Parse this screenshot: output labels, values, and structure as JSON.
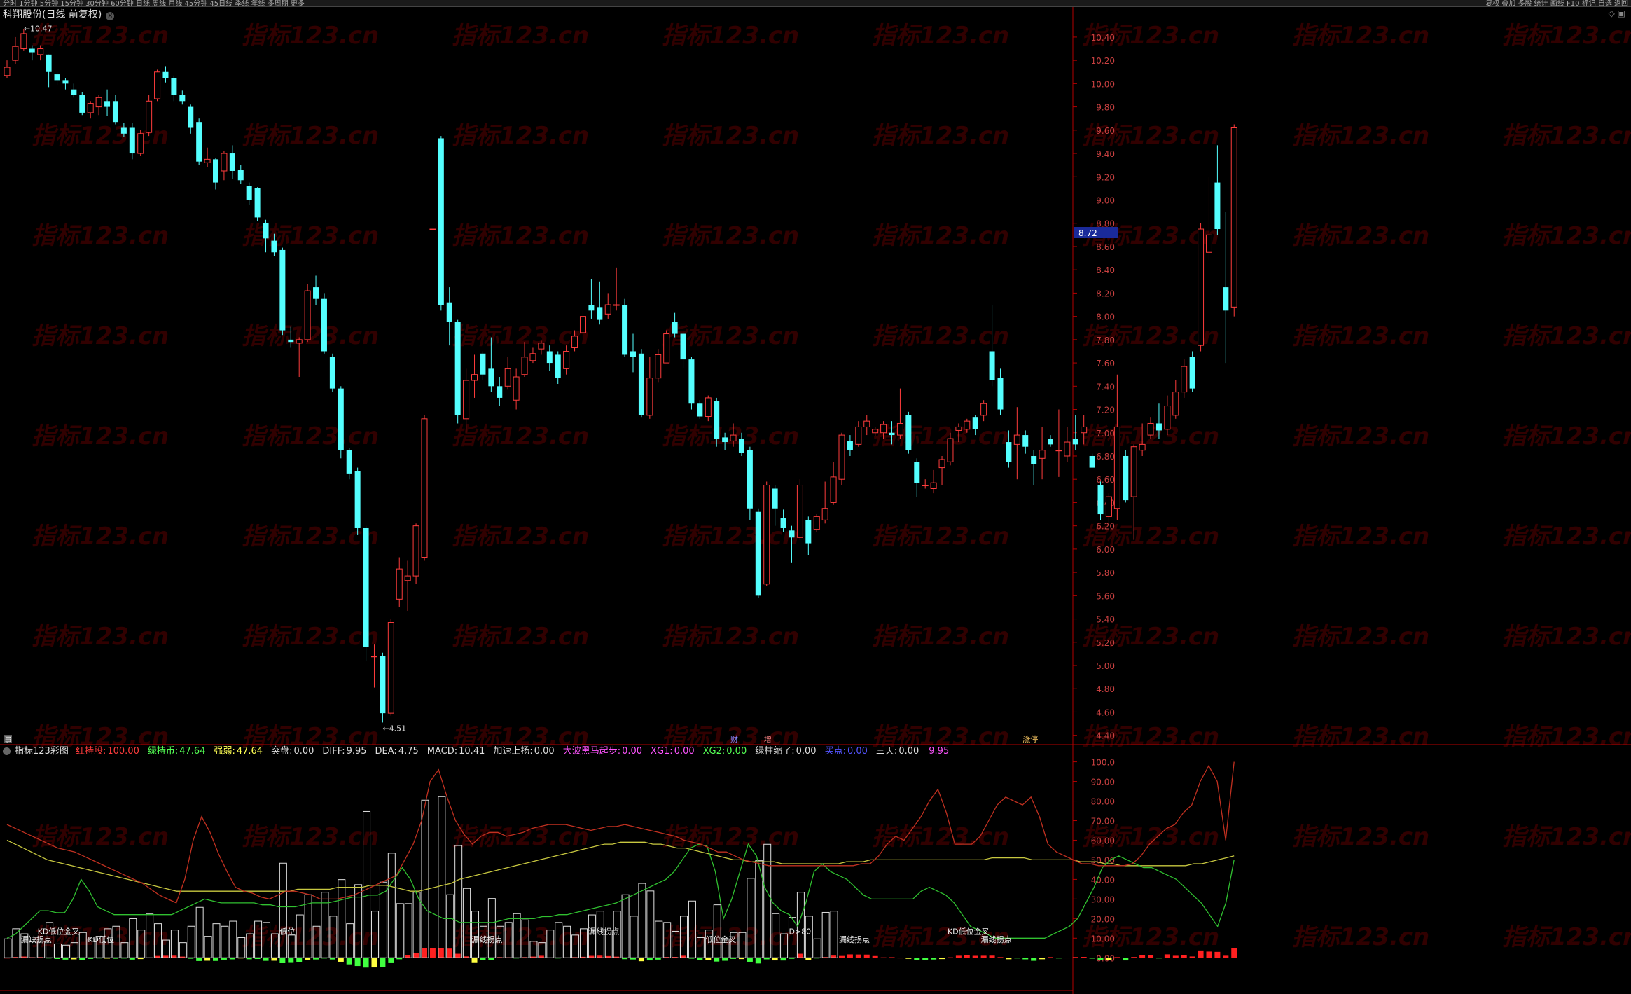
{
  "toolbar_left": "分时 1分钟 5分钟 15分钟 30分钟 60分钟 日线 周线 月线 45分钟 45日线 季线 年线 多周期 更多",
  "toolbar_right": "复权 叠加 多股 统计 画线 F10 标记 自选 返回",
  "title": {
    "name": "科翔股份",
    "mode": "(日线 前复权)"
  },
  "watermark": "指标123.cn",
  "colors": {
    "up": "#ff3c3c",
    "down": "#54ffff",
    "bg": "#000000",
    "axis": "#b40000",
    "grid": "#3c0000"
  },
  "price_axis": {
    "ticks": [
      "10.40",
      "10.20",
      "10.00",
      "9.80",
      "9.60",
      "9.40",
      "9.20",
      "9.00",
      "8.80",
      "8.60",
      "8.40",
      "8.20",
      "8.00",
      "7.80",
      "7.60",
      "7.40",
      "7.20",
      "7.00",
      "6.80",
      "6.60",
      "6.40",
      "6.20",
      "6.00",
      "5.80",
      "5.60",
      "5.40",
      "5.20",
      "5.00",
      "4.80",
      "4.60",
      "4.40"
    ],
    "current": "8.72"
  },
  "annotations": {
    "high": "10.47",
    "low": "4.51"
  },
  "event_markers": [
    "事",
    "财",
    "增",
    "涨停"
  ],
  "chart_data": {
    "type": "candlestick",
    "ylim": [
      4.35,
      10.55
    ],
    "candles": [
      [
        10.07,
        10.14,
        10.05,
        10.2
      ],
      [
        10.2,
        10.32,
        10.17,
        10.4
      ],
      [
        10.3,
        10.43,
        10.28,
        10.47
      ],
      [
        10.3,
        10.27,
        10.2,
        10.33
      ],
      [
        10.25,
        10.3,
        10.2,
        10.33
      ],
      [
        10.25,
        10.1,
        9.97,
        10.25
      ],
      [
        10.08,
        10.03,
        9.99,
        10.1
      ],
      [
        10.03,
        10.0,
        9.95,
        10.05
      ],
      [
        9.95,
        9.9,
        9.88,
        10.0
      ],
      [
        9.9,
        9.75,
        9.73,
        9.93
      ],
      [
        9.75,
        9.83,
        9.7,
        9.85
      ],
      [
        9.8,
        9.88,
        9.73,
        9.9
      ],
      [
        9.85,
        9.8,
        9.72,
        9.95
      ],
      [
        9.85,
        9.67,
        9.65,
        9.9
      ],
      [
        9.62,
        9.57,
        9.54,
        9.66
      ],
      [
        9.62,
        9.4,
        9.35,
        9.66
      ],
      [
        9.4,
        9.57,
        9.38,
        9.6
      ],
      [
        9.58,
        9.85,
        9.55,
        9.9
      ],
      [
        9.87,
        10.1,
        9.85,
        10.12
      ],
      [
        10.1,
        10.05,
        10.01,
        10.15
      ],
      [
        10.05,
        9.9,
        9.85,
        10.07
      ],
      [
        9.9,
        9.85,
        9.82,
        9.94
      ],
      [
        9.8,
        9.62,
        9.57,
        9.82
      ],
      [
        9.67,
        9.33,
        9.3,
        9.7
      ],
      [
        9.32,
        9.35,
        9.28,
        9.45
      ],
      [
        9.35,
        9.15,
        9.09,
        9.36
      ],
      [
        9.25,
        9.4,
        9.17,
        9.42
      ],
      [
        9.4,
        9.25,
        9.18,
        9.47
      ],
      [
        9.26,
        9.17,
        9.14,
        9.3
      ],
      [
        9.12,
        9.0,
        8.96,
        9.15
      ],
      [
        9.1,
        8.85,
        8.82,
        9.11
      ],
      [
        8.8,
        8.67,
        8.55,
        8.83
      ],
      [
        8.65,
        8.55,
        8.52,
        8.71
      ],
      [
        8.57,
        7.88,
        7.84,
        8.59
      ],
      [
        7.8,
        7.78,
        7.73,
        7.91
      ],
      [
        7.77,
        7.8,
        7.48,
        7.82
      ],
      [
        7.8,
        8.22,
        7.78,
        8.28
      ],
      [
        8.25,
        8.15,
        8.1,
        8.35
      ],
      [
        8.15,
        7.7,
        7.68,
        8.2
      ],
      [
        7.65,
        7.38,
        7.35,
        7.68
      ],
      [
        7.38,
        6.85,
        6.78,
        7.4
      ],
      [
        6.85,
        6.65,
        6.6,
        6.87
      ],
      [
        6.67,
        6.18,
        6.12,
        6.7
      ],
      [
        6.18,
        5.16,
        5.04,
        6.2
      ],
      [
        5.08,
        5.08,
        4.81,
        5.18
      ],
      [
        5.08,
        4.59,
        4.51,
        5.11
      ],
      [
        4.59,
        5.37,
        4.57,
        5.4
      ],
      [
        5.57,
        5.83,
        5.5,
        5.93
      ],
      [
        5.73,
        5.77,
        5.47,
        5.9
      ],
      [
        5.77,
        6.2,
        5.7,
        6.22
      ],
      [
        5.93,
        7.12,
        5.9,
        7.15
      ],
      [
        8.75,
        8.75,
        8.75,
        8.75
      ],
      [
        9.53,
        8.1,
        8.05,
        9.55
      ],
      [
        8.12,
        7.95,
        7.75,
        8.25
      ],
      [
        7.95,
        7.15,
        7.08,
        7.97
      ],
      [
        7.12,
        7.45,
        7.0,
        7.55
      ],
      [
        7.45,
        7.5,
        7.3,
        7.67
      ],
      [
        7.68,
        7.5,
        7.45,
        7.7
      ],
      [
        7.55,
        7.4,
        7.35,
        7.82
      ],
      [
        7.4,
        7.3,
        7.23,
        7.48
      ],
      [
        7.4,
        7.55,
        7.37,
        7.65
      ],
      [
        7.28,
        7.48,
        7.2,
        7.55
      ],
      [
        7.5,
        7.65,
        7.48,
        7.78
      ],
      [
        7.62,
        7.68,
        7.6,
        7.73
      ],
      [
        7.72,
        7.77,
        7.67,
        7.79
      ],
      [
        7.7,
        7.6,
        7.53,
        7.75
      ],
      [
        7.67,
        7.47,
        7.42,
        7.7
      ],
      [
        7.55,
        7.7,
        7.5,
        7.75
      ],
      [
        7.73,
        7.83,
        7.7,
        7.88
      ],
      [
        7.86,
        8.0,
        7.82,
        8.05
      ],
      [
        8.1,
        8.05,
        7.98,
        8.32
      ],
      [
        8.08,
        7.97,
        7.93,
        8.3
      ],
      [
        8.02,
        8.1,
        7.98,
        8.2
      ],
      [
        8.1,
        8.1,
        8.05,
        8.42
      ],
      [
        8.1,
        7.67,
        7.65,
        8.15
      ],
      [
        7.7,
        7.65,
        7.52,
        7.85
      ],
      [
        7.68,
        7.15,
        7.13,
        7.72
      ],
      [
        7.15,
        7.47,
        7.12,
        7.65
      ],
      [
        7.47,
        7.67,
        7.43,
        7.72
      ],
      [
        7.6,
        7.85,
        7.6,
        7.88
      ],
      [
        7.95,
        7.85,
        7.82,
        8.03
      ],
      [
        7.85,
        7.63,
        7.55,
        7.88
      ],
      [
        7.63,
        7.25,
        7.2,
        7.65
      ],
      [
        7.25,
        7.14,
        7.12,
        7.28
      ],
      [
        7.14,
        7.3,
        7.1,
        7.32
      ],
      [
        7.27,
        6.95,
        6.88,
        7.3
      ],
      [
        6.96,
        6.92,
        6.85,
        7.0
      ],
      [
        6.93,
        6.98,
        6.88,
        7.08
      ],
      [
        6.95,
        6.83,
        6.8,
        7.0
      ],
      [
        6.85,
        6.35,
        6.25,
        6.88
      ],
      [
        6.32,
        5.6,
        5.58,
        6.35
      ],
      [
        5.7,
        6.55,
        5.68,
        6.58
      ],
      [
        6.52,
        6.35,
        6.2,
        6.55
      ],
      [
        6.27,
        6.18,
        6.15,
        6.34
      ],
      [
        6.16,
        6.1,
        5.88,
        6.2
      ],
      [
        6.1,
        6.55,
        6.08,
        6.6
      ],
      [
        6.25,
        6.05,
        5.95,
        6.28
      ],
      [
        6.17,
        6.28,
        6.15,
        6.3
      ],
      [
        6.25,
        6.35,
        6.22,
        6.58
      ],
      [
        6.4,
        6.62,
        6.38,
        6.75
      ],
      [
        6.6,
        6.98,
        6.55,
        7.0
      ],
      [
        6.93,
        6.85,
        6.8,
        6.98
      ],
      [
        6.9,
        7.05,
        6.88,
        7.1
      ],
      [
        7.05,
        7.1,
        6.98,
        7.15
      ],
      [
        7.0,
        7.03,
        6.97,
        7.05
      ],
      [
        7.0,
        7.07,
        6.95,
        7.1
      ],
      [
        7.0,
        6.98,
        6.9,
        7.1
      ],
      [
        6.98,
        7.08,
        6.95,
        7.38
      ],
      [
        7.15,
        6.85,
        6.82,
        7.18
      ],
      [
        6.75,
        6.57,
        6.45,
        6.78
      ],
      [
        6.55,
        6.55,
        6.52,
        6.6
      ],
      [
        6.52,
        6.57,
        6.48,
        6.68
      ],
      [
        6.7,
        6.77,
        6.55,
        6.8
      ],
      [
        6.75,
        6.95,
        6.72,
        7.0
      ],
      [
        7.02,
        7.05,
        6.92,
        7.08
      ],
      [
        7.03,
        7.1,
        7.0,
        7.12
      ],
      [
        7.13,
        7.03,
        6.98,
        7.15
      ],
      [
        7.15,
        7.25,
        7.1,
        7.28
      ],
      [
        7.7,
        7.45,
        7.4,
        8.1
      ],
      [
        7.47,
        7.2,
        7.15,
        7.55
      ],
      [
        6.92,
        6.75,
        6.7,
        7.02
      ],
      [
        6.9,
        6.98,
        6.6,
        7.22
      ],
      [
        6.98,
        6.88,
        6.82,
        7.02
      ],
      [
        6.8,
        6.73,
        6.55,
        6.85
      ],
      [
        6.78,
        6.85,
        6.6,
        7.05
      ],
      [
        6.95,
        6.9,
        6.88,
        6.98
      ],
      [
        6.85,
        6.85,
        6.62,
        7.2
      ],
      [
        6.8,
        6.92,
        6.75,
        7.05
      ],
      [
        6.95,
        6.9,
        6.85,
        7.15
      ],
      [
        7.0,
        7.05,
        6.9,
        7.15
      ],
      [
        6.8,
        6.7,
        6.7,
        6.82
      ],
      [
        6.55,
        6.3,
        6.25,
        6.58
      ],
      [
        6.28,
        6.45,
        6.2,
        6.48
      ],
      [
        6.35,
        7.05,
        6.25,
        7.5
      ],
      [
        6.8,
        6.42,
        6.4,
        6.85
      ],
      [
        6.45,
        6.88,
        6.08,
        6.9
      ],
      [
        6.85,
        6.9,
        6.8,
        7.08
      ],
      [
        6.98,
        7.08,
        6.95,
        7.13
      ],
      [
        7.08,
        7.02,
        6.95,
        7.25
      ],
      [
        7.03,
        7.23,
        6.98,
        7.32
      ],
      [
        7.15,
        7.35,
        7.12,
        7.45
      ],
      [
        7.35,
        7.57,
        7.3,
        7.63
      ],
      [
        7.65,
        7.38,
        7.35,
        7.7
      ],
      [
        7.75,
        8.75,
        7.7,
        8.8
      ],
      [
        8.55,
        8.7,
        8.48,
        9.2
      ],
      [
        9.15,
        8.75,
        8.7,
        9.47
      ],
      [
        8.25,
        8.05,
        7.6,
        8.9
      ],
      [
        8.08,
        9.62,
        8.0,
        9.65
      ]
    ]
  },
  "indicator": {
    "name": "指标123彩图",
    "legend": [
      {
        "label": "红持股:",
        "value": "100.00",
        "color": "#ff3c3c"
      },
      {
        "label": "绿持币:",
        "value": "47.64",
        "color": "#54ff54"
      },
      {
        "label": "强弱:",
        "value": "47.64",
        "color": "#ffff54"
      },
      {
        "label": "突盘:",
        "value": "0.00",
        "color": "#dddddd"
      },
      {
        "label": "DIFF:",
        "value": "9.95",
        "color": "#dddddd"
      },
      {
        "label": "DEA:",
        "value": "4.75",
        "color": "#dddddd"
      },
      {
        "label": "MACD:",
        "value": "10.41",
        "color": "#dddddd"
      },
      {
        "label": "加速上扬:",
        "value": "0.00",
        "color": "#dddddd"
      },
      {
        "label": "大波黑马起步:",
        "value": "0.00",
        "color": "#ff54ff"
      },
      {
        "label": "XG1:",
        "value": "0.00",
        "color": "#ff54ff"
      },
      {
        "label": "XG2:",
        "value": "0.00",
        "color": "#54ff54"
      },
      {
        "label": "绿柱缩了:",
        "value": "0.00",
        "color": "#dddddd"
      },
      {
        "label": "买点:",
        "value": "0.00",
        "color": "#5454ff"
      },
      {
        "label": "三天:",
        "value": "0.00",
        "color": "#dddddd"
      },
      {
        "label": "",
        "value": "9.95",
        "color": "#ff54ff"
      }
    ],
    "ticks": [
      "100.0",
      "90.00",
      "80.00",
      "70.00",
      "60.00",
      "50.00",
      "40.00",
      "30.00",
      "20.00",
      "10.00",
      "0.00"
    ],
    "labels": [
      "漏缺拐点",
      "KD低位金叉",
      "KD低位",
      "低位",
      "漏线拐点",
      "漏线拐点",
      "低位金叉",
      "D>80",
      "漏线拐点",
      "KD低位金叉",
      "漏线拐点"
    ],
    "ylim": [
      -16,
      102
    ],
    "red_line": [
      68,
      66,
      64,
      62,
      60,
      58,
      56,
      55,
      54,
      52,
      50,
      48,
      46,
      44,
      42,
      40,
      38,
      35,
      32,
      30,
      28,
      40,
      60,
      72,
      64,
      53,
      44,
      36,
      34,
      33,
      31,
      30,
      32,
      34,
      34,
      33,
      32,
      30,
      30,
      30,
      31,
      32,
      34,
      36,
      38,
      40,
      42,
      50,
      58,
      70,
      90,
      96,
      82,
      70,
      63,
      58,
      62,
      64,
      64,
      62,
      63,
      64,
      66,
      67,
      68,
      68,
      68,
      67,
      66,
      65,
      66,
      67,
      67,
      68,
      67,
      66,
      65,
      64,
      63,
      62,
      60,
      59,
      58,
      56,
      54,
      54,
      52,
      50,
      49,
      48,
      47,
      47,
      47,
      47,
      47,
      47,
      47,
      47,
      47,
      47,
      47,
      48,
      48,
      52,
      58,
      62,
      60,
      66,
      72,
      80,
      86,
      74,
      58,
      58,
      58,
      62,
      70,
      78,
      82,
      80,
      78,
      82,
      72,
      58,
      54,
      52,
      50,
      48,
      48,
      47,
      47,
      47,
      47,
      48,
      52,
      58,
      62,
      66,
      68,
      74,
      78,
      90,
      98,
      90,
      60,
      100
    ],
    "green_line": [
      10,
      12,
      16,
      20,
      24,
      24,
      23,
      23,
      30,
      40,
      34,
      26,
      24,
      22,
      22,
      22,
      22,
      22,
      22,
      22,
      22,
      24,
      26,
      28,
      30,
      29,
      28,
      28,
      28,
      28,
      28,
      27,
      27,
      26,
      26,
      26,
      27,
      28,
      28,
      28,
      29,
      30,
      31,
      31,
      32,
      32,
      34,
      40,
      46,
      40,
      30,
      24,
      22,
      20,
      20,
      18,
      18,
      18,
      18,
      18,
      19,
      20,
      20,
      20,
      20,
      21,
      21,
      22,
      22,
      23,
      24,
      25,
      26,
      27,
      28,
      30,
      32,
      34,
      36,
      38,
      40,
      44,
      50,
      56,
      58,
      57,
      44,
      20,
      30,
      44,
      58,
      52,
      36,
      28,
      24,
      22,
      16,
      28,
      44,
      48,
      44,
      42,
      40,
      36,
      32,
      30,
      30,
      30,
      30,
      30,
      30,
      34,
      36,
      34,
      32,
      28,
      22,
      16,
      14,
      12,
      10,
      10,
      10,
      10,
      10,
      10,
      10,
      12,
      14,
      16,
      20,
      28,
      36,
      46,
      50,
      52,
      50,
      48,
      46,
      46,
      44,
      42,
      40,
      36,
      32,
      28,
      22,
      16,
      28,
      50
    ],
    "yellow_line": [
      60,
      58,
      56,
      54,
      52,
      50,
      49,
      48,
      47,
      46,
      45,
      44,
      43,
      42,
      41,
      40,
      39,
      38,
      37,
      36,
      35,
      34,
      34,
      34,
      34,
      34,
      34,
      34,
      34,
      34,
      34,
      34,
      34,
      34,
      34,
      34,
      35,
      35,
      35,
      35,
      35,
      36,
      36,
      36,
      36,
      37,
      37,
      37,
      36,
      35,
      34,
      34,
      35,
      36,
      37,
      38,
      40,
      41,
      42,
      43,
      44,
      45,
      46,
      47,
      48,
      49,
      50,
      51,
      52,
      53,
      54,
      55,
      56,
      57,
      58,
      58,
      59,
      59,
      59,
      59,
      58,
      58,
      57,
      56,
      56,
      55,
      54,
      53,
      52,
      51,
      50,
      50,
      49,
      49,
      49,
      49,
      48,
      48,
      48,
      48,
      48,
      48,
      48,
      48,
      49,
      49,
      49,
      50,
      50,
      50,
      50,
      50,
      50,
      50,
      50,
      50,
      50,
      50,
      50,
      50,
      50,
      50,
      51,
      51,
      51,
      51,
      51,
      50,
      50,
      50,
      50,
      50,
      50,
      49,
      49,
      49,
      48,
      48,
      47,
      47,
      47,
      47,
      47,
      47,
      47,
      47,
      47,
      48,
      48,
      49,
      50,
      51,
      52
    ]
  }
}
